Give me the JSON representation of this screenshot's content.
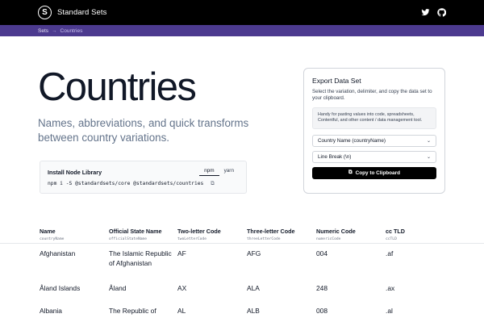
{
  "header": {
    "brand": "Standard Sets",
    "logo_letter": "S",
    "icons": [
      "twitter-icon",
      "github-icon"
    ]
  },
  "breadcrumb": {
    "items": [
      "Sets",
      "Countries"
    ],
    "separator": "→"
  },
  "hero": {
    "title": "Countries",
    "subtitle": "Names, abbreviations, and quick transforms between country variations."
  },
  "install": {
    "label": "Install Node Library",
    "tabs": [
      "npm",
      "yarn"
    ],
    "active_tab": "npm",
    "command": "npm i -S @standardsets/core @standardsets/countries"
  },
  "export": {
    "title": "Export Data Set",
    "description": "Select the variation, delimiter, and copy the data set to your clipboard.",
    "hint": "Handy for pasting values into code, spreadsheets, Contentful, and other content / data management tool.",
    "variation_value": "Country Name (countryName)",
    "delimiter_value": "Line Break (\\n)",
    "copy_button": "Copy to Clipboard"
  },
  "table": {
    "columns": [
      {
        "label": "Name",
        "key": "countryName"
      },
      {
        "label": "Official State Name",
        "key": "officialStateName"
      },
      {
        "label": "Two-letter Code",
        "key": "twoLetterCode"
      },
      {
        "label": "Three-letter Code",
        "key": "threeLetterCode"
      },
      {
        "label": "Numeric Code",
        "key": "numericCode"
      },
      {
        "label": "cc TLD",
        "key": "ccTLD"
      }
    ],
    "rows": [
      [
        "Afghanistan",
        "The Islamic Republic of Afghanistan",
        "AF",
        "AFG",
        "004",
        ".af"
      ],
      [
        "Åland Islands",
        "Åland",
        "AX",
        "ALA",
        "248",
        ".ax"
      ],
      [
        "Albania",
        "The Republic of Albania",
        "AL",
        "ALB",
        "008",
        ".al"
      ]
    ]
  },
  "colors": {
    "topbar": "#000000",
    "breadcrumb_bar": "#4c3a8f",
    "subtitle": "#64748b"
  }
}
